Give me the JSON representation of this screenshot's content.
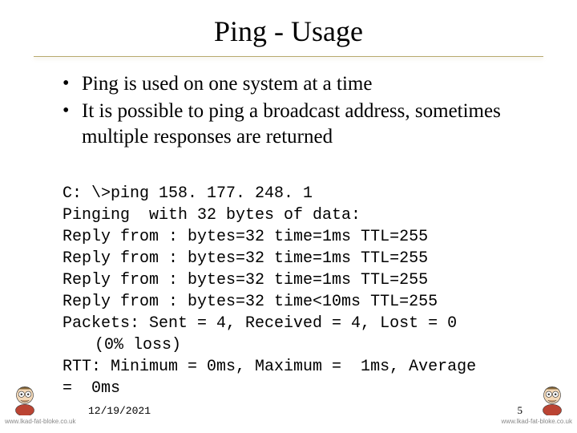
{
  "title": "Ping - Usage",
  "bullets": [
    "Ping is used on one system at a time",
    "It is possible to ping a broadcast address, sometimes multiple responses are returned"
  ],
  "terminal": {
    "cmd": "C: \\>ping 158. 177. 248. 1",
    "pinging": "Pinging  with 32 bytes of data:",
    "reply1": "Reply from : bytes=32 time=1ms TTL=255",
    "reply2": "Reply from : bytes=32 time=1ms TTL=255",
    "reply3": "Reply from : bytes=32 time=1ms TTL=255",
    "reply4": "Reply from : bytes=32 time<10ms TTL=255",
    "packets": "Packets: Sent = 4, Received = 4, Lost = 0",
    "packets_cont": "(0% loss)",
    "rtt": "RTT: Minimum = 0ms, Maximum =  1ms, Average",
    "rtt_cont_eq": "=",
    "rtt_cont_val": "0ms"
  },
  "footer": {
    "date": "12/19/2021",
    "page": "5",
    "watermark": "www.lkad-fat-bloke.co.uk"
  }
}
